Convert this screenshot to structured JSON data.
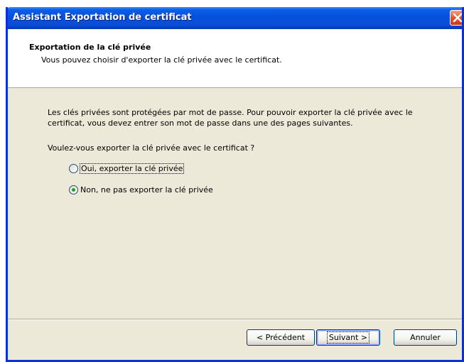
{
  "window": {
    "title": "Assistant Exportation de certificat"
  },
  "header": {
    "title": "Exportation de la clé privée",
    "subtitle": "Vous pouvez choisir d'exporter la clé privée avec le certificat."
  },
  "content": {
    "description": "Les clés privées sont protégées par mot de passe. Pour pouvoir exporter la clé privée avec le certificat, vous devez entrer son mot de passe dans une des pages suivantes.",
    "question": "Voulez-vous exporter la clé privée avec le certificat ?",
    "options": [
      {
        "label": "Oui, exporter la clé privée",
        "selected": false
      },
      {
        "label": "Non, ne pas exporter la clé privée",
        "selected": true
      }
    ]
  },
  "buttons": {
    "back": "< Précédent",
    "next": "Suivant >",
    "cancel": "Annuler"
  },
  "icons": {
    "close": "close-icon"
  },
  "colors": {
    "titlebar": "#0550dc",
    "dialog_bg": "#ece9d8",
    "close_button": "#e0552f",
    "radio_check": "#21a121"
  }
}
